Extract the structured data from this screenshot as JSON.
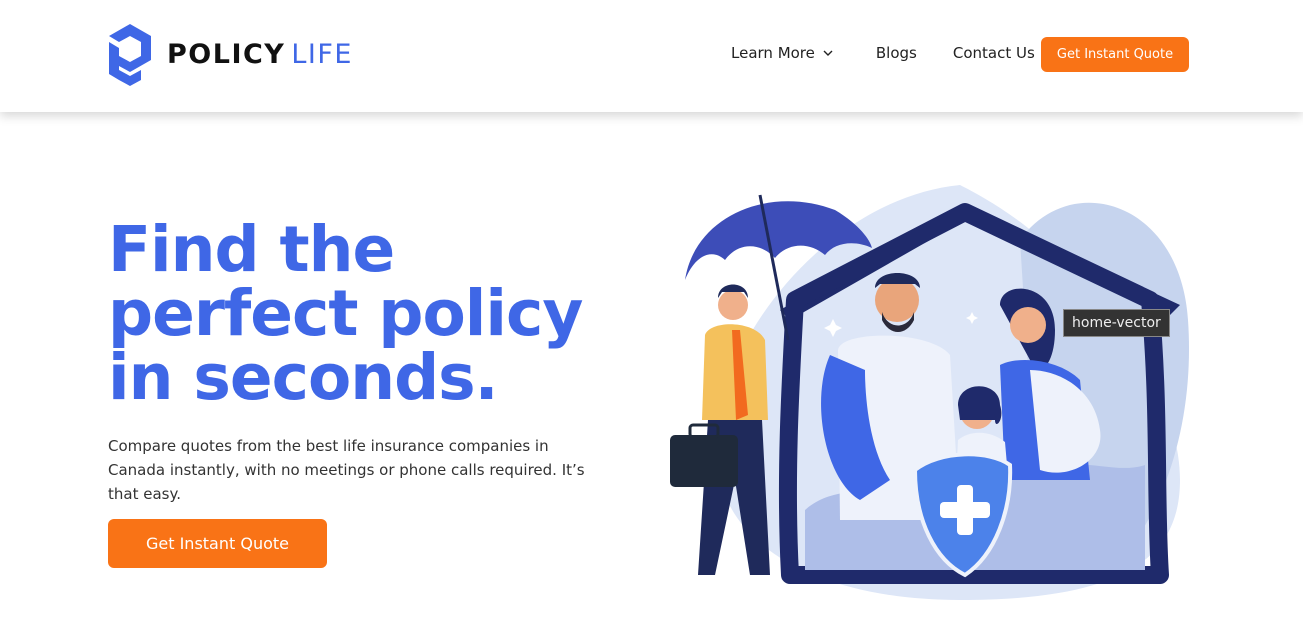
{
  "brand": {
    "name_bold": "POLICY",
    "name_light": "LIFE",
    "logo_icon": "policylife-logo-icon",
    "primary_color": "#3f67e6",
    "accent_color": "#f97316"
  },
  "nav": {
    "items": [
      {
        "label": "Learn More",
        "icon": "chevron-down-icon"
      },
      {
        "label": "Blogs"
      },
      {
        "label": "Contact Us"
      }
    ],
    "cta_label": "Get Instant Quote"
  },
  "hero": {
    "title": "Find the perfect policy in seconds.",
    "subtitle": "Compare quotes from the best life insurance companies in Canada instantly, with no meetings or phone calls required. It’s that easy.",
    "cta_label": "Get Instant Quote"
  },
  "illustration": {
    "name": "home-vector",
    "tooltip": "home-vector"
  }
}
